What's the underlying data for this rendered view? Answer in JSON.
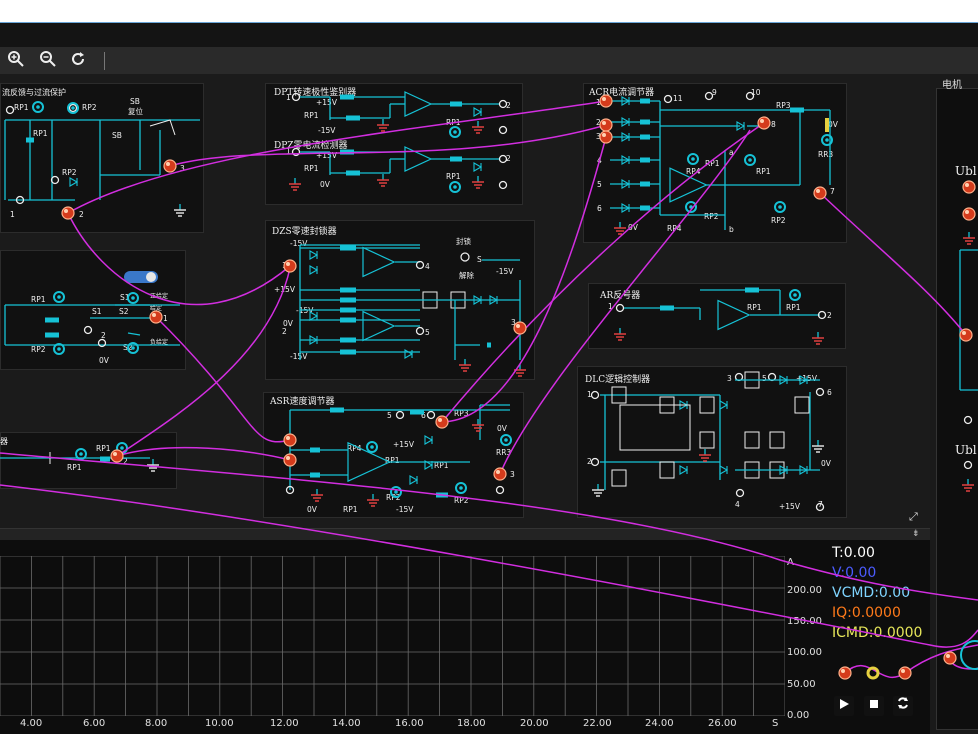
{
  "toolbar": {
    "icons": [
      "zoom-in-icon",
      "zoom-out-icon",
      "refresh-icon"
    ]
  },
  "modules": {
    "overcurrent": {
      "title": "流反馈与过流保护",
      "rp1": "RP1",
      "rp2": "RP2",
      "sb": "SB",
      "sb2": "复位",
      "rp1b": "RP1",
      "sbb": "SB",
      "rp2b": "RP2",
      "n3": "3",
      "n1": "1",
      "n2": "2"
    },
    "dpt": {
      "title": "DPT转速极性鉴别器",
      "v15": "+15V",
      "rp1": "RP1",
      "m15": "-15V",
      "rp1b": "RP1",
      "n1": "1",
      "n2": "2"
    },
    "dpz": {
      "title": "DPZ零电流检测器",
      "v15": "+15V",
      "rp1": "RP1",
      "ov": "0V",
      "rp1b": "RP1",
      "n1": "1",
      "n2": "2"
    },
    "acr": {
      "title": "ACR电流调节器",
      "n1": "1",
      "n2": "2",
      "n3": "3",
      "n4": "4",
      "n5": "5",
      "n6": "6",
      "n7": "7",
      "n8": "8",
      "n9": "9",
      "n10": "10",
      "n11": "11",
      "rp3": "RP3",
      "ov": "0V",
      "rr3": "RR3",
      "rp4": "RP4",
      "rp1": "RP1",
      "rp1b": "RP1",
      "a": "a",
      "b": "b",
      "rp2": "RP2",
      "rp2b": "RP2",
      "ov2": "0V",
      "rp4b": "RP4"
    },
    "dzs": {
      "title": "DZS零速封锁器",
      "m15": "-15V",
      "p15": "+15V",
      "m15b": "-15V",
      "m15c": "-15V",
      "ov": "0V",
      "fs": "封锁",
      "s": "S",
      "jc": "解除",
      "m15d": "-15V",
      "n1": "1",
      "n2": "2",
      "n3": "3",
      "n4": "4",
      "n5": "5"
    },
    "ar": {
      "title": "AR反号器",
      "n1": "1",
      "n2": "2",
      "rp1": "RP1",
      "rp1b": "RP1"
    },
    "dlc": {
      "title": "DLC逻辑控制器",
      "n1": "1",
      "n2": "2",
      "n3": "3",
      "n4": "4",
      "n5": "5",
      "n6": "6",
      "n7": "7",
      "p15": "+15V",
      "ov": "0V",
      "p15b": "+15V"
    },
    "asr": {
      "title": "ASR速度调节器",
      "n5": "5",
      "n6": "6",
      "rp3": "RP3",
      "ov": "0V",
      "rr3": "RR3",
      "rp4": "RP4",
      "p15": "+15V",
      "rp1": "RP1",
      "rp1b": "RP1",
      "rp2": "RP2",
      "rp2b": "RP2",
      "m15": "-15V",
      "rp1c": "RP1",
      "ov2": "0V",
      "n3": "3"
    },
    "switches": {
      "rp1": "RP1",
      "s1": "S1",
      "s1b": "S1",
      "s2": "S2",
      "s2b": "S2",
      "pos": "正给定",
      "neg": "负给定",
      "zero": "给定",
      "rp2": "RP2",
      "ov": "0V",
      "n1": "1",
      "n2": "2"
    },
    "lower": {
      "title": "器",
      "rp1": "RP1",
      "rp1b": "RP1",
      "n2": "2"
    }
  },
  "rightpanel": {
    "title": "电机",
    "ubl1": "Ubl",
    "ubl2": "Ubl"
  },
  "scope": {
    "yticks": [
      "A",
      "200.00",
      "150.00",
      "100.00",
      "50.00",
      "0.00"
    ],
    "xticks": [
      "4.00",
      "6.00",
      "8.00",
      "10.00",
      "12.00",
      "14.00",
      "16.00",
      "18.00",
      "20.00",
      "22.00",
      "24.00",
      "26.00",
      "S"
    ],
    "readouts": {
      "t": "T:0.00",
      "v": "V:0.00",
      "vcmd": "VCMD:0.00",
      "iq": "IQ:0.0000",
      "icmd": "ICMD:0.0000"
    },
    "colors": {
      "t": "#ffffff",
      "v": "#4b5bff",
      "vcmd": "#7fd4ff",
      "iq": "#ff7a1a",
      "icmd": "#e6e65a"
    },
    "buttons": [
      "play-icon",
      "stop-icon",
      "cycle-icon"
    ]
  },
  "colors": {
    "wire": "#d22ee0",
    "circuit": "#16c2d6",
    "bg": "#111111"
  }
}
